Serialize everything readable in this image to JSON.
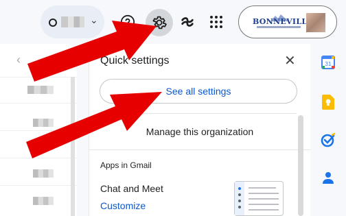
{
  "header": {
    "status_chevron": "⌄",
    "help_icon": "help-circle-icon",
    "settings_icon": "gear-icon",
    "gemini_icon": "gemini-icon",
    "apps_icon": "apps-grid-icon",
    "org_logo_text": "BONNEVILLE"
  },
  "mail_nav": {
    "prev": "‹",
    "next": "›"
  },
  "quick_settings": {
    "title": "Quick settings",
    "close": "✕",
    "see_all_label": "See all settings",
    "manage_org_label": "Manage this organization",
    "apps_heading": "Apps in Gmail",
    "chat_meet_label": "Chat and Meet",
    "customize_label": "Customize"
  },
  "side_rail": {
    "icons": [
      "calendar-icon",
      "keep-icon",
      "tasks-icon",
      "contacts-icon"
    ],
    "calendar_day": "31"
  },
  "colors": {
    "link_blue": "#0b57d0",
    "arrow_red": "#e60000",
    "gear_highlight": "#d3d6db"
  }
}
